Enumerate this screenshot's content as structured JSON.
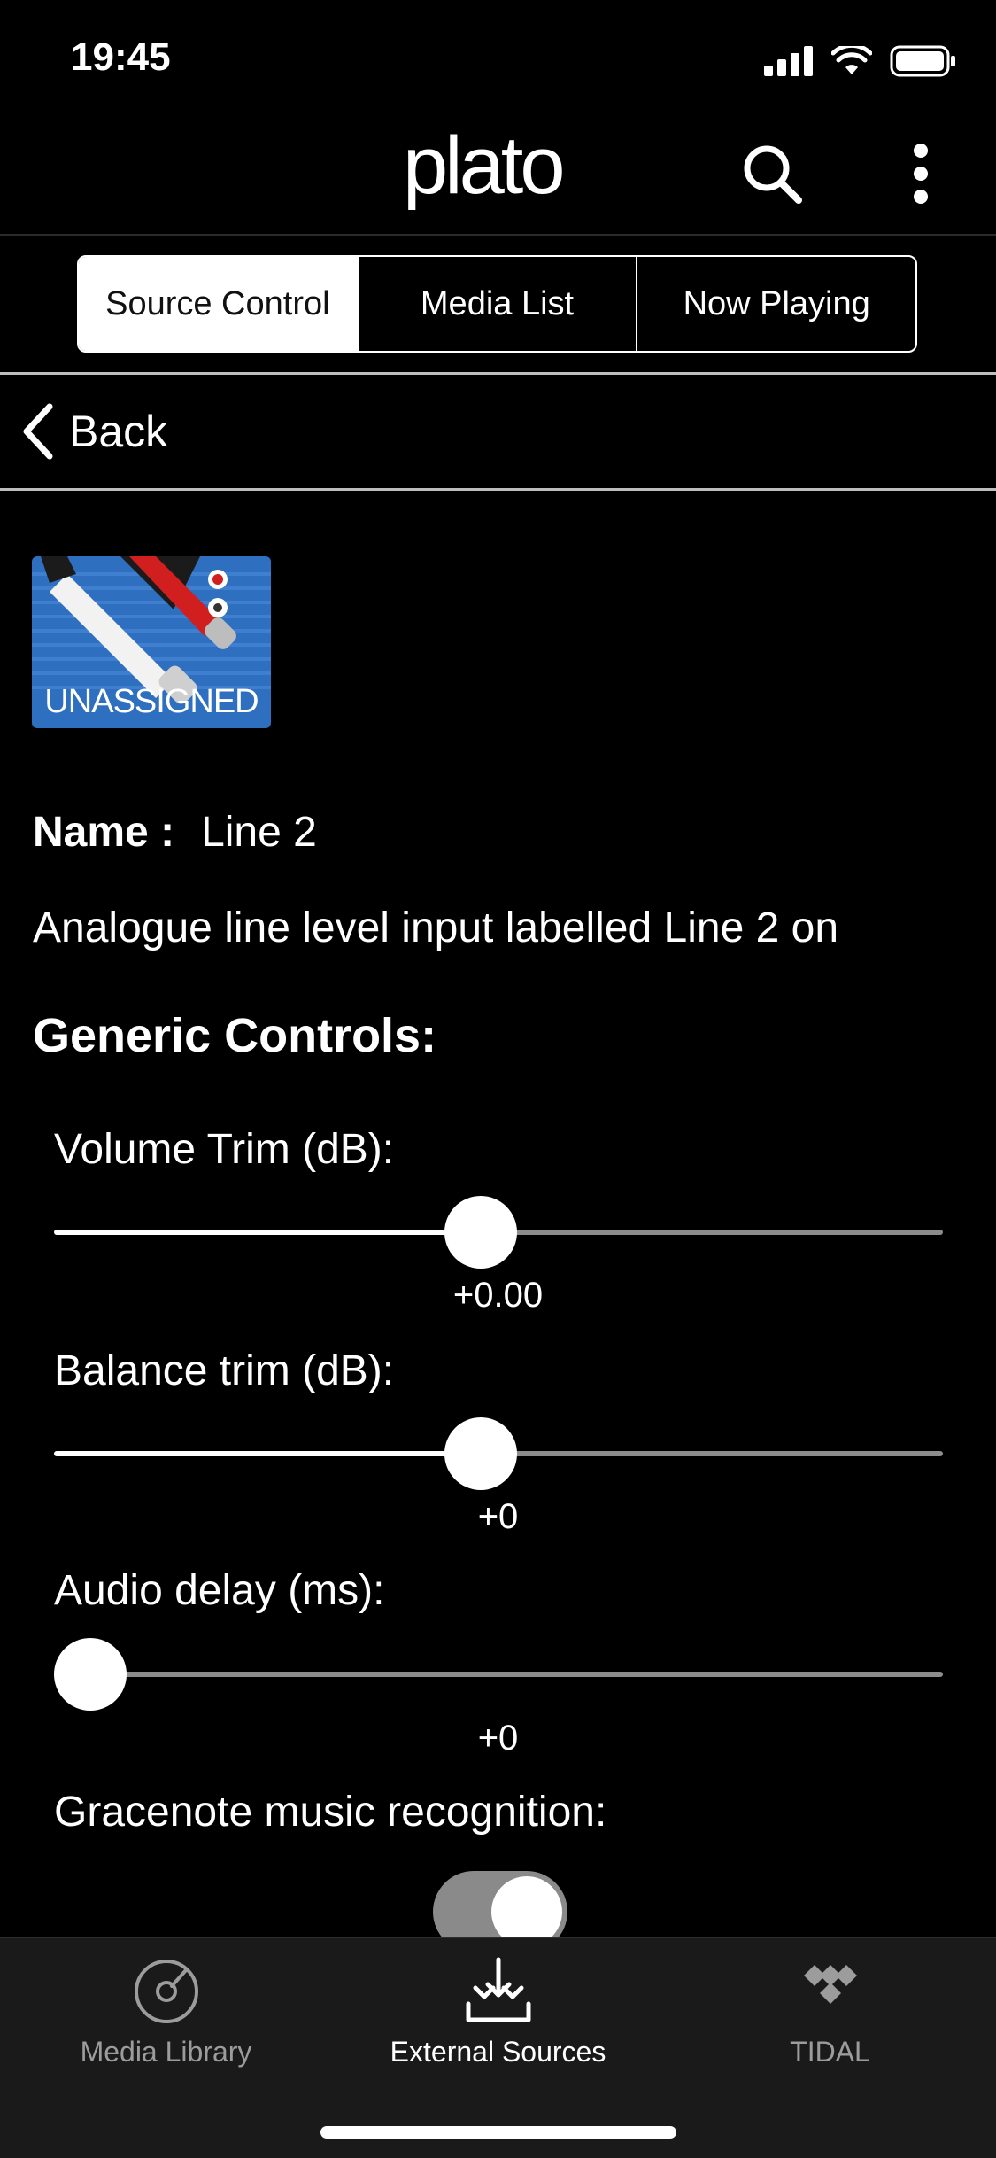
{
  "status": {
    "time": "19:45"
  },
  "header": {
    "logo_text": "plato"
  },
  "segments": [
    {
      "label": "Source Control",
      "active": true
    },
    {
      "label": "Media List",
      "active": false
    },
    {
      "label": "Now Playing",
      "active": false
    }
  ],
  "back": {
    "label": "Back"
  },
  "source": {
    "badge": "UNASSIGNED",
    "name_label": "Name :",
    "name_value": "Line 2",
    "description": "Analogue line level input labelled Line 2 on"
  },
  "generic_controls": {
    "title": "Generic Controls:",
    "volume": {
      "label": "Volume Trim (dB):",
      "value": "+0.00",
      "level_fraction": 0.5
    },
    "balance": {
      "label": "Balance trim (dB):",
      "value": "+0",
      "level_fraction": 0.5
    },
    "delay": {
      "label": "Audio delay (ms):",
      "value": "+0",
      "level_fraction": 0.0
    },
    "gracenote": {
      "label": "Gracenote music recognition:",
      "on": true
    }
  },
  "tabbar": {
    "tabs": [
      {
        "label": "Media Library",
        "icon": "vinyl-record-icon",
        "active": false
      },
      {
        "label": "External Sources",
        "icon": "download-tray-icon",
        "active": true
      },
      {
        "label": "TIDAL",
        "icon": "tidal-logo-icon",
        "active": false
      }
    ]
  },
  "colors": {
    "background": "#000000",
    "track_filled": "#ffffff",
    "track_empty": "#8c8c8c",
    "source_blue": "#2f6fbf",
    "tabbar_bg": "#1a1a1a"
  }
}
